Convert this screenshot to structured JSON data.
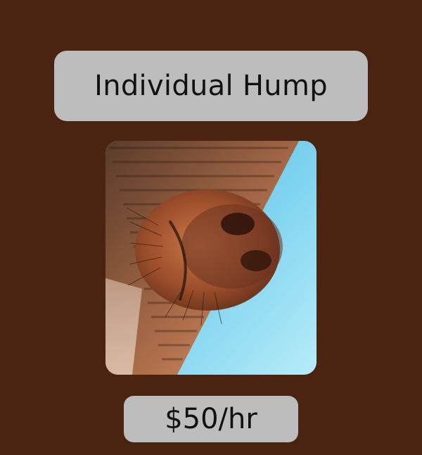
{
  "service": {
    "title": "Individual Hump",
    "price": "$50/hr"
  },
  "image": {
    "subject": "horse-muzzle-under-roof",
    "icon": "horse-photo-icon"
  },
  "colors": {
    "background": "#4a2410",
    "pill": "#bdbdbd",
    "text": "#111111",
    "sky": "#7fcfe6"
  }
}
